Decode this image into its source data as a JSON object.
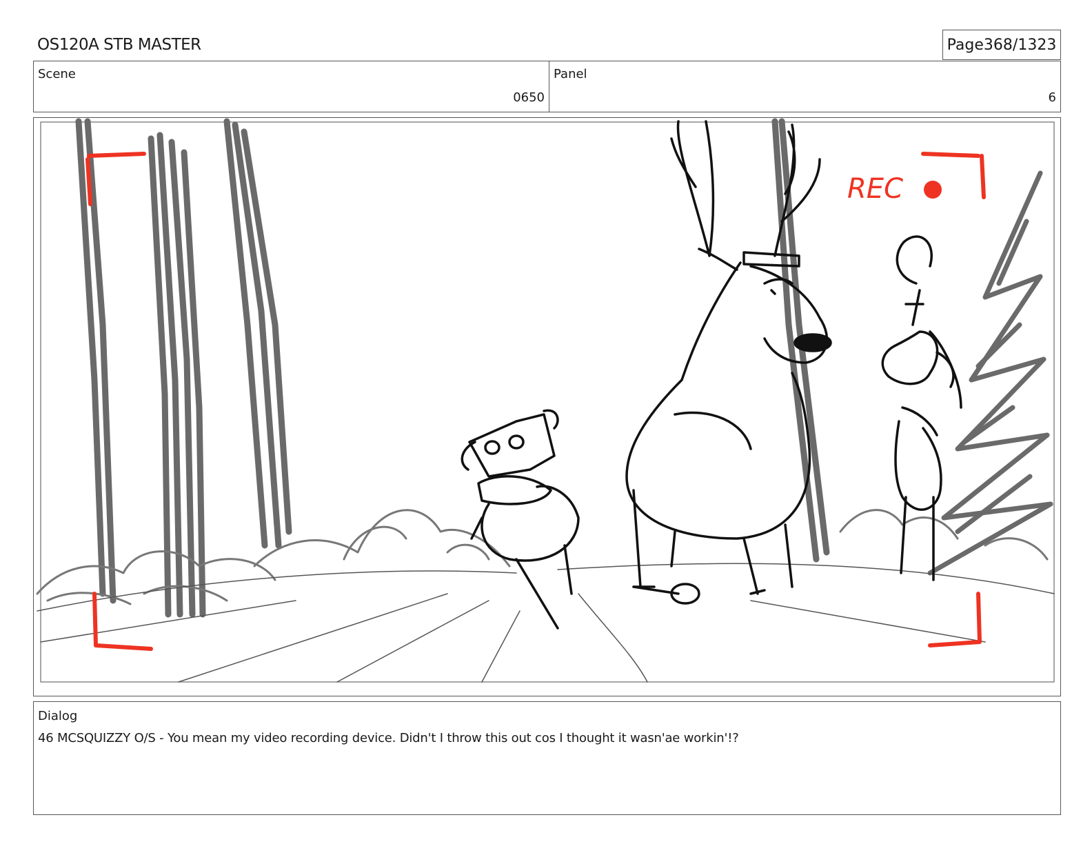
{
  "header": {
    "title": "OS120A STB MASTER",
    "page_label": "Page",
    "page_value": "368/1323"
  },
  "scene": {
    "label": "Scene",
    "value": "0650"
  },
  "panel": {
    "label": "Panel",
    "value": "6"
  },
  "artwork": {
    "rec_text": "REC",
    "colors": {
      "rec_red": "#ee3322",
      "tree_gray": "#6a6a6a",
      "line": "#111111"
    }
  },
  "dialog": {
    "label": "Dialog",
    "text": "46 MCSQUIZZY O/S - You mean my video recording device. Didn't I throw this out cos I thought it wasn'ae workin'!?"
  }
}
